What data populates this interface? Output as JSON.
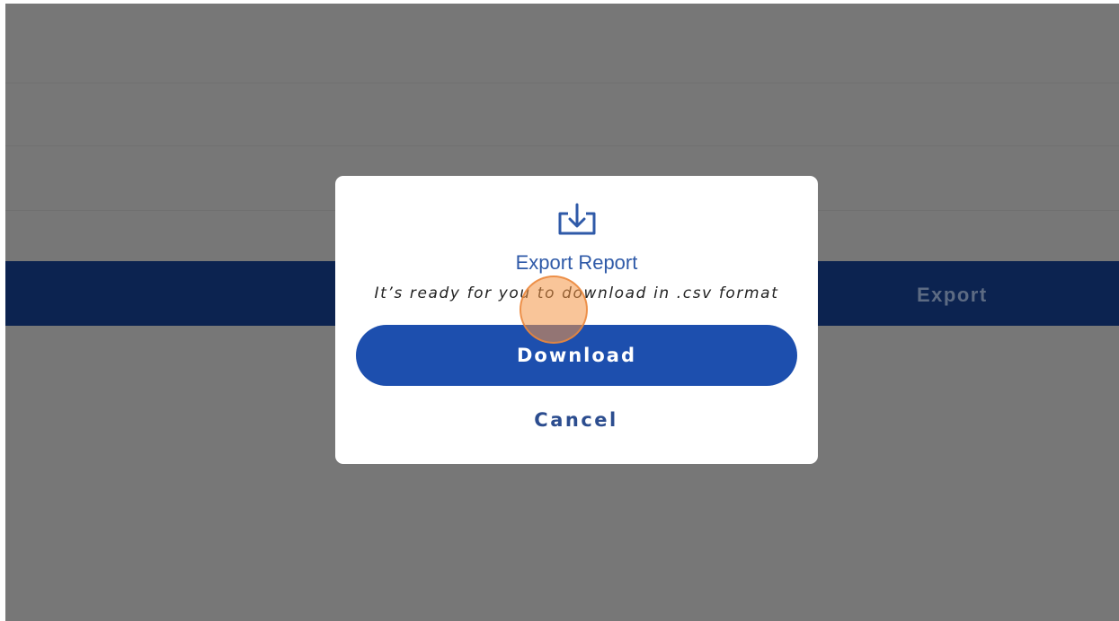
{
  "background": {
    "export_label": "Export"
  },
  "dialog": {
    "icon": "download-tray-icon",
    "title": "Export Report",
    "subtitle": "It’s ready for you to download in .csv format",
    "primary_button": "Download",
    "secondary_button": "Cancel"
  },
  "colors": {
    "overlay": "#777777",
    "bar": "#0c2350",
    "accent": "#1d4fae",
    "title": "#2f5aa8",
    "click_indicator": "#f49646"
  }
}
